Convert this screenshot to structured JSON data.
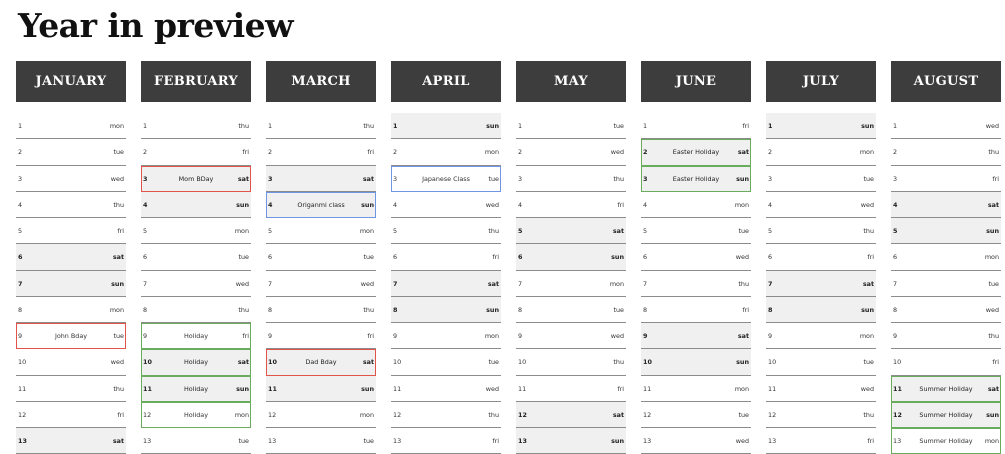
{
  "page_title": "Year in preview",
  "colors": {
    "header_bg": "#3d3d3d",
    "weekend_bg": "#f0f0f0",
    "red": "#e0544a",
    "blue": "#6f95e3",
    "green": "#6aac5e"
  },
  "months": [
    {
      "name": "JANUARY",
      "days": [
        {
          "n": "1",
          "d": "mon",
          "w": false,
          "e": "",
          "c": ""
        },
        {
          "n": "2",
          "d": "tue",
          "w": false,
          "e": "",
          "c": ""
        },
        {
          "n": "3",
          "d": "wed",
          "w": false,
          "e": "",
          "c": ""
        },
        {
          "n": "4",
          "d": "thu",
          "w": false,
          "e": "",
          "c": ""
        },
        {
          "n": "5",
          "d": "fri",
          "w": false,
          "e": "",
          "c": ""
        },
        {
          "n": "6",
          "d": "sat",
          "w": true,
          "e": "",
          "c": ""
        },
        {
          "n": "7",
          "d": "sun",
          "w": true,
          "e": "",
          "c": ""
        },
        {
          "n": "8",
          "d": "mon",
          "w": false,
          "e": "",
          "c": ""
        },
        {
          "n": "9",
          "d": "tue",
          "w": false,
          "e": "John Bday",
          "c": "red"
        },
        {
          "n": "10",
          "d": "wed",
          "w": false,
          "e": "",
          "c": ""
        },
        {
          "n": "11",
          "d": "thu",
          "w": false,
          "e": "",
          "c": ""
        },
        {
          "n": "12",
          "d": "fri",
          "w": false,
          "e": "",
          "c": ""
        },
        {
          "n": "13",
          "d": "sat",
          "w": true,
          "e": "",
          "c": ""
        }
      ]
    },
    {
      "name": "FEBRUARY",
      "days": [
        {
          "n": "1",
          "d": "thu",
          "w": false,
          "e": "",
          "c": ""
        },
        {
          "n": "2",
          "d": "fri",
          "w": false,
          "e": "",
          "c": ""
        },
        {
          "n": "3",
          "d": "sat",
          "w": true,
          "e": "Mom BDay",
          "c": "red"
        },
        {
          "n": "4",
          "d": "sun",
          "w": true,
          "e": "",
          "c": ""
        },
        {
          "n": "5",
          "d": "mon",
          "w": false,
          "e": "",
          "c": ""
        },
        {
          "n": "6",
          "d": "tue",
          "w": false,
          "e": "",
          "c": ""
        },
        {
          "n": "7",
          "d": "wed",
          "w": false,
          "e": "",
          "c": ""
        },
        {
          "n": "8",
          "d": "thu",
          "w": false,
          "e": "",
          "c": ""
        },
        {
          "n": "9",
          "d": "fri",
          "w": false,
          "e": "Holiday",
          "c": "green"
        },
        {
          "n": "10",
          "d": "sat",
          "w": true,
          "e": "Holiday",
          "c": "green"
        },
        {
          "n": "11",
          "d": "sun",
          "w": true,
          "e": "Holiday",
          "c": "green"
        },
        {
          "n": "12",
          "d": "mon",
          "w": false,
          "e": "Holiday",
          "c": "green"
        },
        {
          "n": "13",
          "d": "tue",
          "w": false,
          "e": "",
          "c": ""
        }
      ]
    },
    {
      "name": "MARCH",
      "days": [
        {
          "n": "1",
          "d": "thu",
          "w": false,
          "e": "",
          "c": ""
        },
        {
          "n": "2",
          "d": "fri",
          "w": false,
          "e": "",
          "c": ""
        },
        {
          "n": "3",
          "d": "sat",
          "w": true,
          "e": "",
          "c": ""
        },
        {
          "n": "4",
          "d": "sun",
          "w": true,
          "e": "Origanmi class",
          "c": "blue"
        },
        {
          "n": "5",
          "d": "mon",
          "w": false,
          "e": "",
          "c": ""
        },
        {
          "n": "6",
          "d": "tue",
          "w": false,
          "e": "",
          "c": ""
        },
        {
          "n": "7",
          "d": "wed",
          "w": false,
          "e": "",
          "c": ""
        },
        {
          "n": "8",
          "d": "thu",
          "w": false,
          "e": "",
          "c": ""
        },
        {
          "n": "9",
          "d": "fri",
          "w": false,
          "e": "",
          "c": ""
        },
        {
          "n": "10",
          "d": "sat",
          "w": true,
          "e": "Dad Bday",
          "c": "red"
        },
        {
          "n": "11",
          "d": "sun",
          "w": true,
          "e": "",
          "c": ""
        },
        {
          "n": "12",
          "d": "mon",
          "w": false,
          "e": "",
          "c": ""
        },
        {
          "n": "13",
          "d": "tue",
          "w": false,
          "e": "",
          "c": ""
        }
      ]
    },
    {
      "name": "APRIL",
      "days": [
        {
          "n": "1",
          "d": "sun",
          "w": true,
          "e": "",
          "c": ""
        },
        {
          "n": "2",
          "d": "mon",
          "w": false,
          "e": "",
          "c": ""
        },
        {
          "n": "3",
          "d": "tue",
          "w": false,
          "e": "Japanese Class",
          "c": "blue"
        },
        {
          "n": "4",
          "d": "wed",
          "w": false,
          "e": "",
          "c": ""
        },
        {
          "n": "5",
          "d": "thu",
          "w": false,
          "e": "",
          "c": ""
        },
        {
          "n": "6",
          "d": "fri",
          "w": false,
          "e": "",
          "c": ""
        },
        {
          "n": "7",
          "d": "sat",
          "w": true,
          "e": "",
          "c": ""
        },
        {
          "n": "8",
          "d": "sun",
          "w": true,
          "e": "",
          "c": ""
        },
        {
          "n": "9",
          "d": "mon",
          "w": false,
          "e": "",
          "c": ""
        },
        {
          "n": "10",
          "d": "tue",
          "w": false,
          "e": "",
          "c": ""
        },
        {
          "n": "11",
          "d": "wed",
          "w": false,
          "e": "",
          "c": ""
        },
        {
          "n": "12",
          "d": "thu",
          "w": false,
          "e": "",
          "c": ""
        },
        {
          "n": "13",
          "d": "fri",
          "w": false,
          "e": "",
          "c": ""
        }
      ]
    },
    {
      "name": "MAY",
      "days": [
        {
          "n": "1",
          "d": "tue",
          "w": false,
          "e": "",
          "c": ""
        },
        {
          "n": "2",
          "d": "wed",
          "w": false,
          "e": "",
          "c": ""
        },
        {
          "n": "3",
          "d": "thu",
          "w": false,
          "e": "",
          "c": ""
        },
        {
          "n": "4",
          "d": "fri",
          "w": false,
          "e": "",
          "c": ""
        },
        {
          "n": "5",
          "d": "sat",
          "w": true,
          "e": "",
          "c": ""
        },
        {
          "n": "6",
          "d": "sun",
          "w": true,
          "e": "",
          "c": ""
        },
        {
          "n": "7",
          "d": "mon",
          "w": false,
          "e": "",
          "c": ""
        },
        {
          "n": "8",
          "d": "tue",
          "w": false,
          "e": "",
          "c": ""
        },
        {
          "n": "9",
          "d": "wed",
          "w": false,
          "e": "",
          "c": ""
        },
        {
          "n": "10",
          "d": "thu",
          "w": false,
          "e": "",
          "c": ""
        },
        {
          "n": "11",
          "d": "fri",
          "w": false,
          "e": "",
          "c": ""
        },
        {
          "n": "12",
          "d": "sat",
          "w": true,
          "e": "",
          "c": ""
        },
        {
          "n": "13",
          "d": "sun",
          "w": true,
          "e": "",
          "c": ""
        }
      ]
    },
    {
      "name": "JUNE",
      "days": [
        {
          "n": "1",
          "d": "fri",
          "w": false,
          "e": "",
          "c": ""
        },
        {
          "n": "2",
          "d": "sat",
          "w": true,
          "e": "Easter Holiday",
          "c": "green"
        },
        {
          "n": "3",
          "d": "sun",
          "w": true,
          "e": "Easter Holiday",
          "c": "green"
        },
        {
          "n": "4",
          "d": "mon",
          "w": false,
          "e": "",
          "c": ""
        },
        {
          "n": "5",
          "d": "tue",
          "w": false,
          "e": "",
          "c": ""
        },
        {
          "n": "6",
          "d": "wed",
          "w": false,
          "e": "",
          "c": ""
        },
        {
          "n": "7",
          "d": "thu",
          "w": false,
          "e": "",
          "c": ""
        },
        {
          "n": "8",
          "d": "fri",
          "w": false,
          "e": "",
          "c": ""
        },
        {
          "n": "9",
          "d": "sat",
          "w": true,
          "e": "",
          "c": ""
        },
        {
          "n": "10",
          "d": "sun",
          "w": true,
          "e": "",
          "c": ""
        },
        {
          "n": "11",
          "d": "mon",
          "w": false,
          "e": "",
          "c": ""
        },
        {
          "n": "12",
          "d": "tue",
          "w": false,
          "e": "",
          "c": ""
        },
        {
          "n": "13",
          "d": "wed",
          "w": false,
          "e": "",
          "c": ""
        }
      ]
    },
    {
      "name": "JULY",
      "days": [
        {
          "n": "1",
          "d": "sun",
          "w": true,
          "e": "",
          "c": ""
        },
        {
          "n": "2",
          "d": "mon",
          "w": false,
          "e": "",
          "c": ""
        },
        {
          "n": "3",
          "d": "tue",
          "w": false,
          "e": "",
          "c": ""
        },
        {
          "n": "4",
          "d": "wed",
          "w": false,
          "e": "",
          "c": ""
        },
        {
          "n": "5",
          "d": "thu",
          "w": false,
          "e": "",
          "c": ""
        },
        {
          "n": "6",
          "d": "fri",
          "w": false,
          "e": "",
          "c": ""
        },
        {
          "n": "7",
          "d": "sat",
          "w": true,
          "e": "",
          "c": ""
        },
        {
          "n": "8",
          "d": "sun",
          "w": true,
          "e": "",
          "c": ""
        },
        {
          "n": "9",
          "d": "mon",
          "w": false,
          "e": "",
          "c": ""
        },
        {
          "n": "10",
          "d": "tue",
          "w": false,
          "e": "",
          "c": ""
        },
        {
          "n": "11",
          "d": "wed",
          "w": false,
          "e": "",
          "c": ""
        },
        {
          "n": "12",
          "d": "thu",
          "w": false,
          "e": "",
          "c": ""
        },
        {
          "n": "13",
          "d": "fri",
          "w": false,
          "e": "",
          "c": ""
        }
      ]
    },
    {
      "name": "AUGUST",
      "days": [
        {
          "n": "1",
          "d": "wed",
          "w": false,
          "e": "",
          "c": ""
        },
        {
          "n": "2",
          "d": "thu",
          "w": false,
          "e": "",
          "c": ""
        },
        {
          "n": "3",
          "d": "fri",
          "w": false,
          "e": "",
          "c": ""
        },
        {
          "n": "4",
          "d": "sat",
          "w": true,
          "e": "",
          "c": ""
        },
        {
          "n": "5",
          "d": "sun",
          "w": true,
          "e": "",
          "c": ""
        },
        {
          "n": "6",
          "d": "mon",
          "w": false,
          "e": "",
          "c": ""
        },
        {
          "n": "7",
          "d": "tue",
          "w": false,
          "e": "",
          "c": ""
        },
        {
          "n": "8",
          "d": "wed",
          "w": false,
          "e": "",
          "c": ""
        },
        {
          "n": "9",
          "d": "thu",
          "w": false,
          "e": "",
          "c": ""
        },
        {
          "n": "10",
          "d": "fri",
          "w": false,
          "e": "",
          "c": ""
        },
        {
          "n": "11",
          "d": "sat",
          "w": true,
          "e": "Summer Holiday",
          "c": "green"
        },
        {
          "n": "12",
          "d": "sun",
          "w": true,
          "e": "Summer Holiday",
          "c": "green"
        },
        {
          "n": "13",
          "d": "mon",
          "w": false,
          "e": "Summer Holiday",
          "c": "green"
        }
      ]
    }
  ]
}
